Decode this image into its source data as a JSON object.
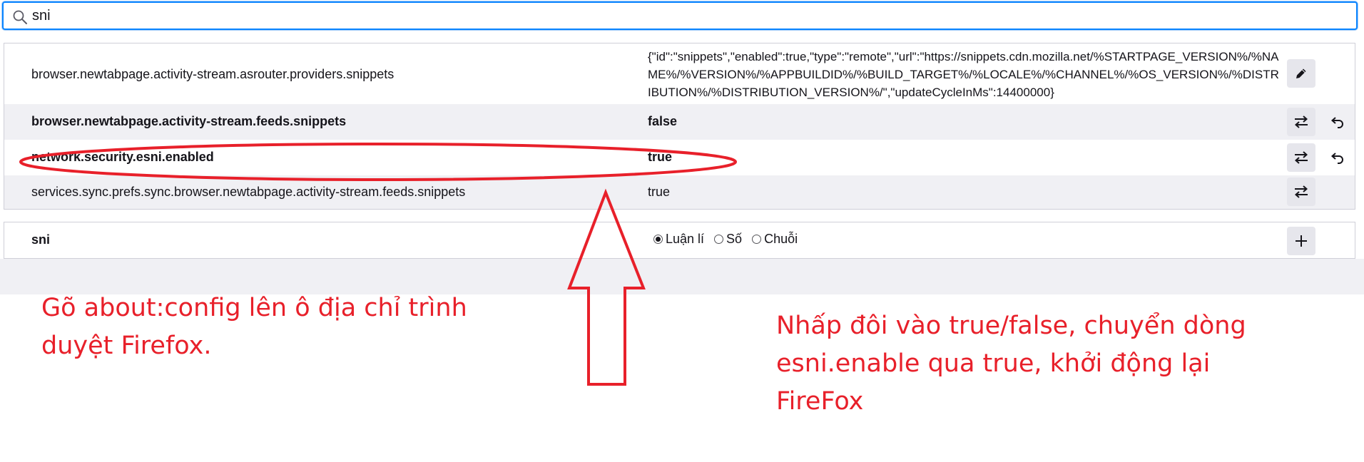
{
  "search": {
    "value": "sni",
    "icon": "search-icon"
  },
  "prefs": [
    {
      "name": "browser.newtabpage.activity-stream.asrouter.providers.snippets",
      "value": "{\"id\":\"snippets\",\"enabled\":true,\"type\":\"remote\",\"url\":\"https://snippets.cdn.mozilla.net/%STARTPAGE_VERSION%/%NAME%/%VERSION%/%APPBUILDID%/%BUILD_TARGET%/%LOCALE%/%CHANNEL%/%OS_VERSION%/%DISTRIBUTION%/%DISTRIBUTION_VERSION%/\",\"updateCycleInMs\":14400000}",
      "modified": false,
      "action_icon": "pencil-icon"
    },
    {
      "name": "browser.newtabpage.activity-stream.feeds.snippets",
      "value": "false",
      "modified": true,
      "action_icon": "toggle-icon",
      "reset_icon": "reset-icon"
    },
    {
      "name": "network.security.esni.enabled",
      "value": "true",
      "modified": true,
      "action_icon": "toggle-icon",
      "reset_icon": "reset-icon"
    },
    {
      "name": "services.sync.prefs.sync.browser.newtabpage.activity-stream.feeds.snippets",
      "value": "true",
      "modified": false,
      "action_icon": "toggle-icon"
    }
  ],
  "new_pref": {
    "name": "sni",
    "types": [
      {
        "label": "Luận lí",
        "selected": true
      },
      {
        "label": "Số",
        "selected": false
      },
      {
        "label": "Chuỗi",
        "selected": false
      }
    ],
    "add_icon": "plus-icon"
  },
  "annotations": {
    "left": "Gõ about:config lên ô địa chỉ trình duyệt Firefox.",
    "right": "Nhấp đôi vào true/false, chuyển dòng esni.enable qua true, khởi động lại FireFox"
  },
  "colors": {
    "accent": "#0a84ff",
    "annotation": "#e8202a",
    "row_alt": "#f0f0f4",
    "button": "#e6e6ec"
  }
}
